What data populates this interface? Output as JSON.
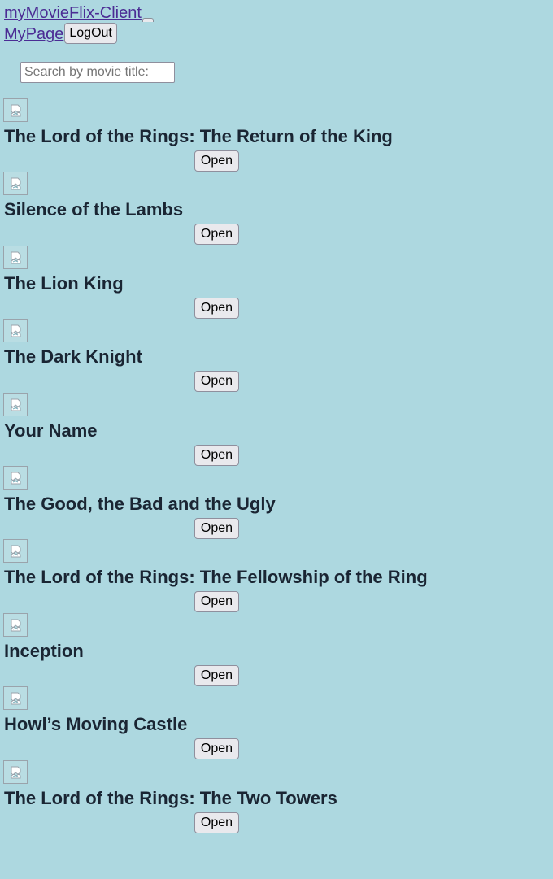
{
  "nav": {
    "brand": "myMovieFlix-Client",
    "mypage": "MyPage",
    "logout": "LogOut"
  },
  "search": {
    "placeholder": "Search by movie title:",
    "value": ""
  },
  "movies": [
    {
      "title": "The Lord of the Rings: The Return of the King",
      "open_label": "Open"
    },
    {
      "title": "Silence of the Lambs",
      "open_label": "Open"
    },
    {
      "title": "The Lion King",
      "open_label": "Open"
    },
    {
      "title": "The Dark Knight",
      "open_label": "Open"
    },
    {
      "title": "Your Name",
      "open_label": "Open"
    },
    {
      "title": "The Good, the Bad and the Ugly",
      "open_label": "Open"
    },
    {
      "title": "The Lord of the Rings: The Fellowship of the Ring",
      "open_label": "Open"
    },
    {
      "title": "Inception",
      "open_label": "Open"
    },
    {
      "title": "Howl’s Moving Castle",
      "open_label": "Open"
    },
    {
      "title": "The Lord of the Rings: The Two Towers",
      "open_label": "Open"
    }
  ],
  "colors": {
    "background": "#add8e0",
    "link": "#4b2c94",
    "title_text": "#1a2533"
  },
  "icons": {
    "movie_poster": "broken-image-icon"
  }
}
